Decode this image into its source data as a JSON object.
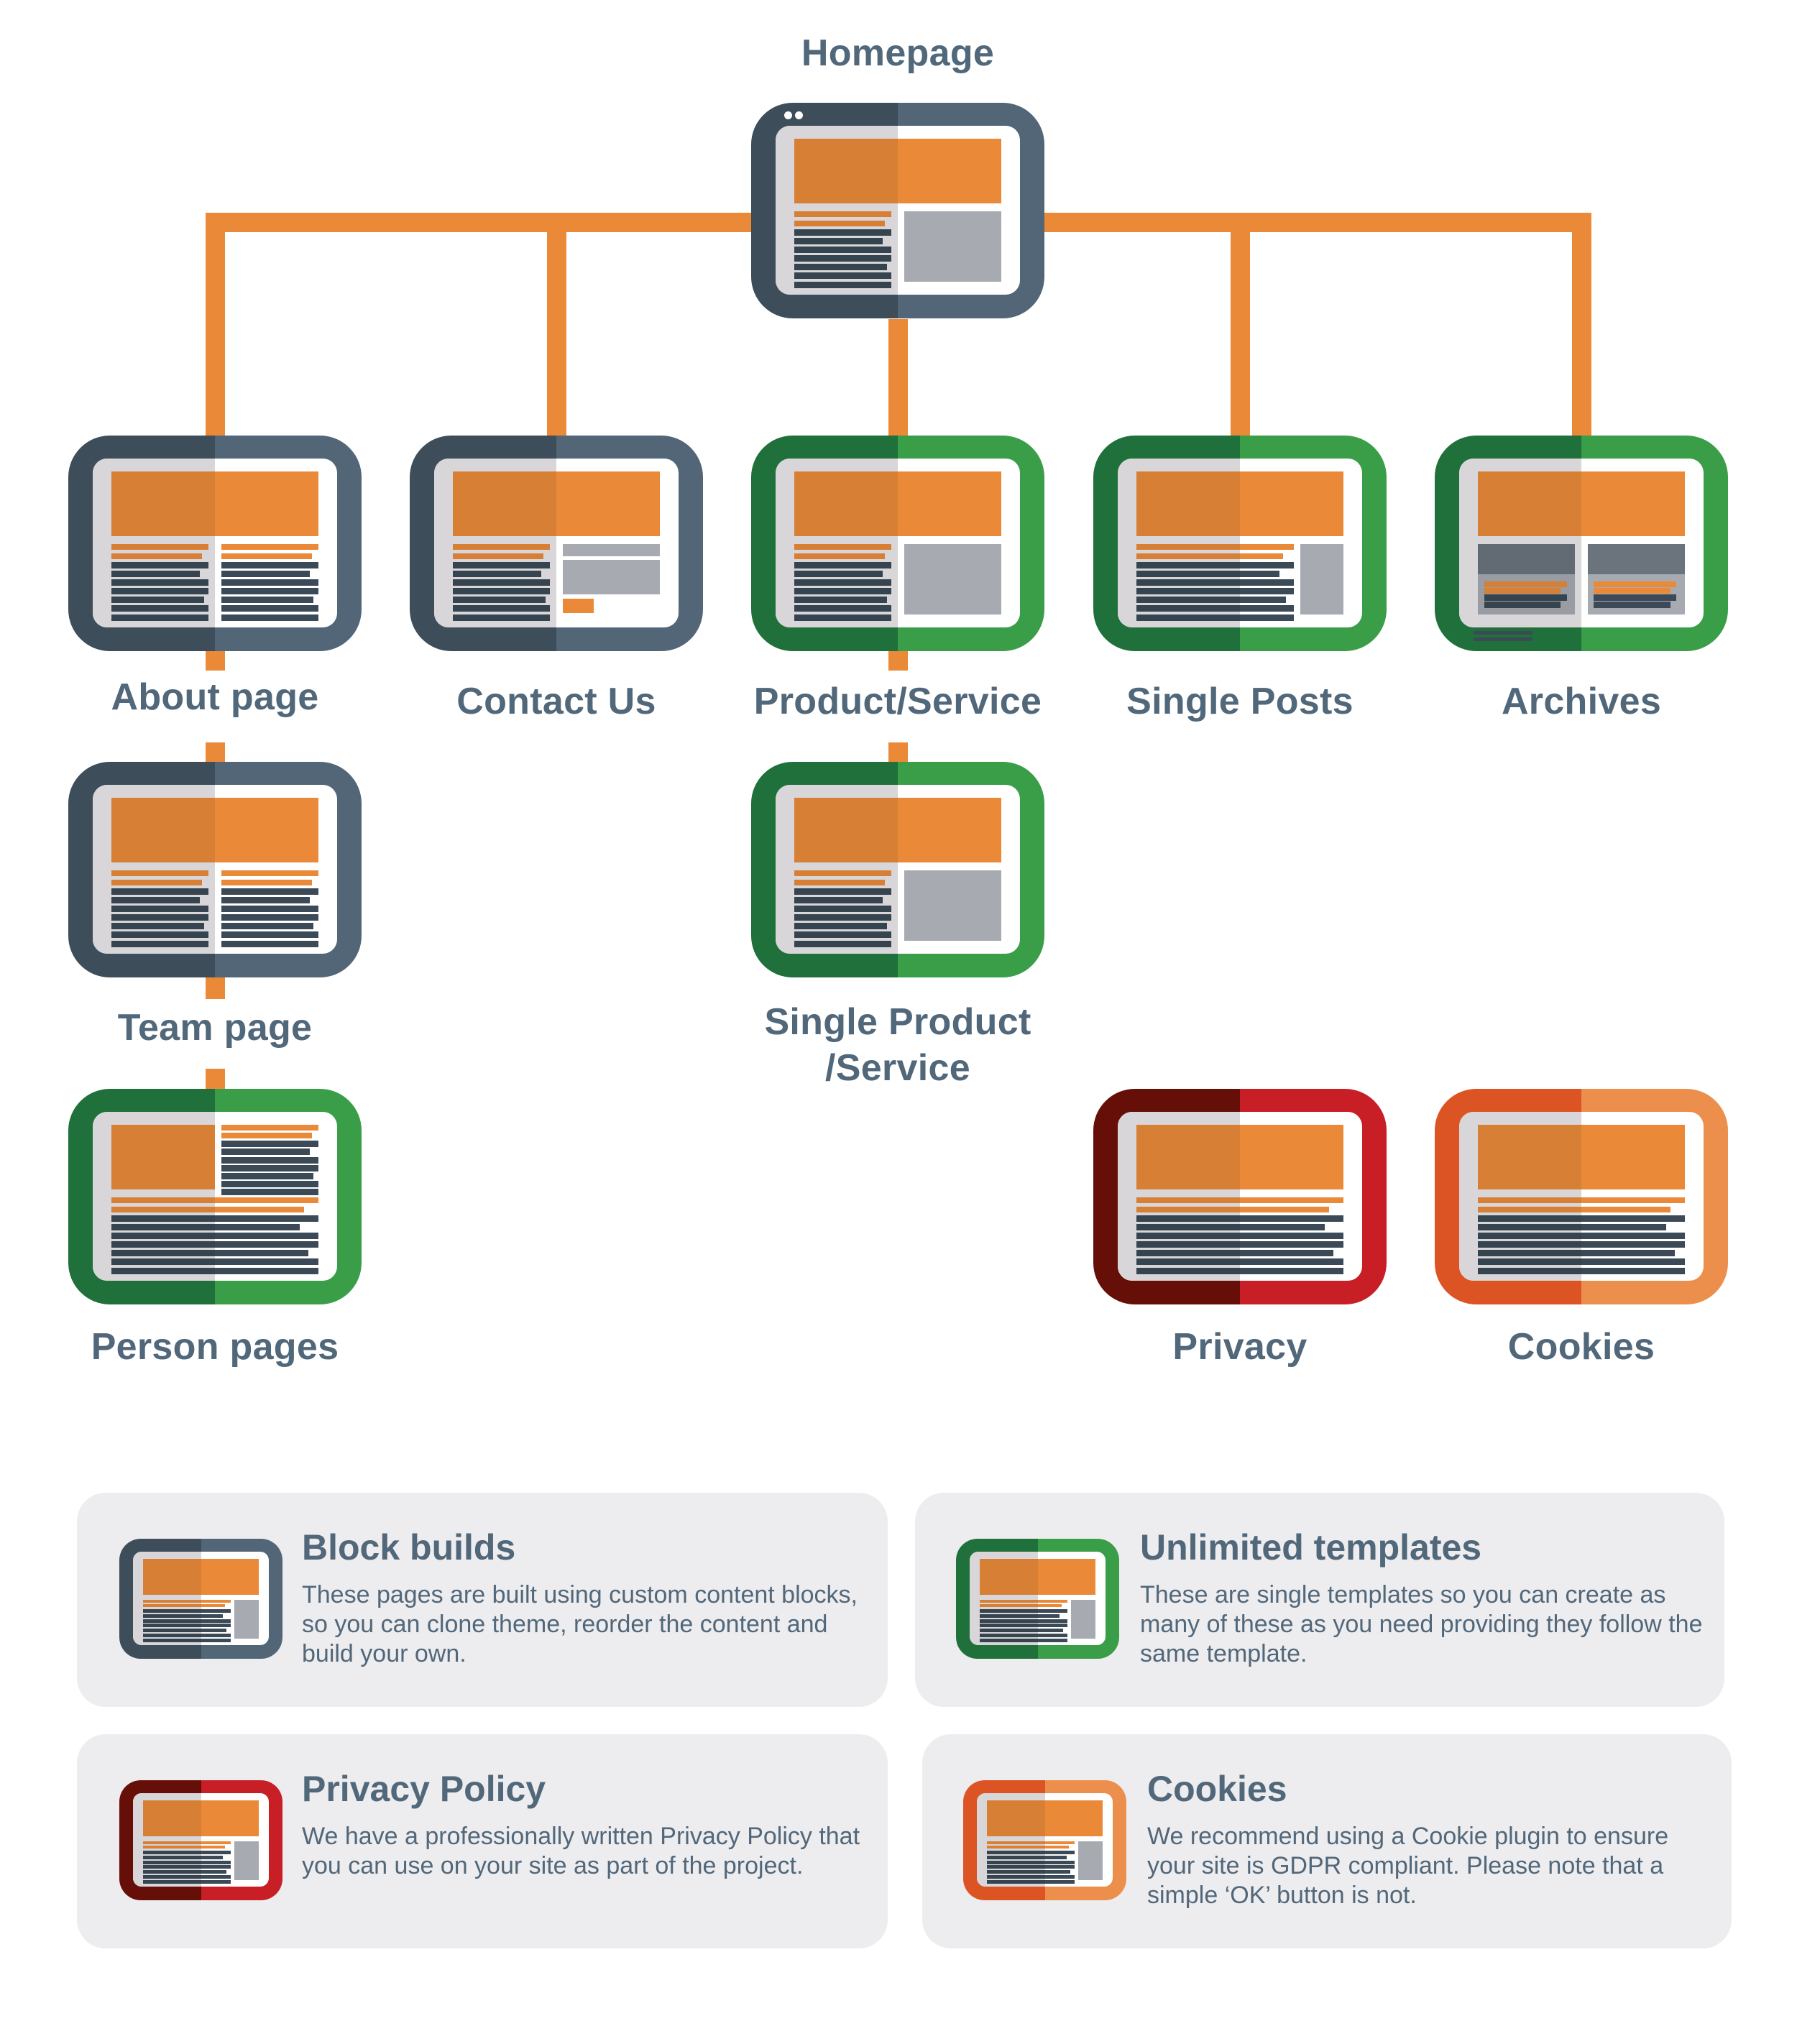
{
  "diagram": {
    "nodes": [
      {
        "id": "homepage",
        "label": "Homepage",
        "type": "block",
        "layout": "hero-text-image"
      },
      {
        "id": "about",
        "label": "About page",
        "type": "block",
        "layout": "hero-two-columns"
      },
      {
        "id": "contact",
        "label": "Contact Us",
        "type": "block",
        "layout": "hero-text-form"
      },
      {
        "id": "product",
        "label": "Product/Service",
        "type": "template",
        "layout": "hero-text-image"
      },
      {
        "id": "posts",
        "label": "Single Posts",
        "type": "template",
        "layout": "hero-text-sidebar"
      },
      {
        "id": "archives",
        "label": "Archives",
        "type": "template",
        "layout": "hero-cards"
      },
      {
        "id": "team",
        "label": "Team page",
        "type": "block",
        "layout": "hero-two-columns"
      },
      {
        "id": "single_product",
        "label_lines": [
          "Single Product",
          "/Service"
        ],
        "type": "template",
        "layout": "hero-text-image"
      },
      {
        "id": "person",
        "label": "Person pages",
        "type": "template",
        "layout": "image-text-fulltext"
      },
      {
        "id": "privacy",
        "label": "Privacy",
        "type": "privacy",
        "layout": "hero-fulltext"
      },
      {
        "id": "cookies",
        "label": "Cookies",
        "type": "cookies",
        "layout": "hero-fulltext"
      }
    ],
    "edges": [
      [
        "homepage",
        "about"
      ],
      [
        "homepage",
        "contact"
      ],
      [
        "homepage",
        "product"
      ],
      [
        "homepage",
        "posts"
      ],
      [
        "homepage",
        "archives"
      ],
      [
        "about",
        "team"
      ],
      [
        "team",
        "person"
      ],
      [
        "product",
        "single_product"
      ]
    ],
    "connector_color": "#ea8a39",
    "label_color": "#51677a"
  },
  "types": {
    "block": {
      "dark": "#3d4d5a",
      "light": "#526677"
    },
    "template": {
      "dark": "#1f703a",
      "light": "#3a9e48"
    },
    "privacy": {
      "dark": "#650f08",
      "light": "#c81e26"
    },
    "cookies": {
      "dark": "#dc5424",
      "light": "#ec8f4c"
    }
  },
  "legend": [
    {
      "type": "block",
      "title": "Block builds",
      "text": "These pages are built using custom content blocks, so you can clone theme, reorder the content and build your own."
    },
    {
      "type": "template",
      "title": "Unlimited templates",
      "text": "These are single templates so you can create as many of these as you need providing they follow the same template."
    },
    {
      "type": "privacy",
      "title": "Privacy Policy",
      "text": "We have a professionally written Privacy Policy that you can use on your site as part of the project."
    },
    {
      "type": "cookies",
      "title": "Cookies",
      "text": "We recommend using a Cookie plugin to ensure your site is GDPR compliant. Please note that a simple ‘OK’ button is not."
    }
  ]
}
